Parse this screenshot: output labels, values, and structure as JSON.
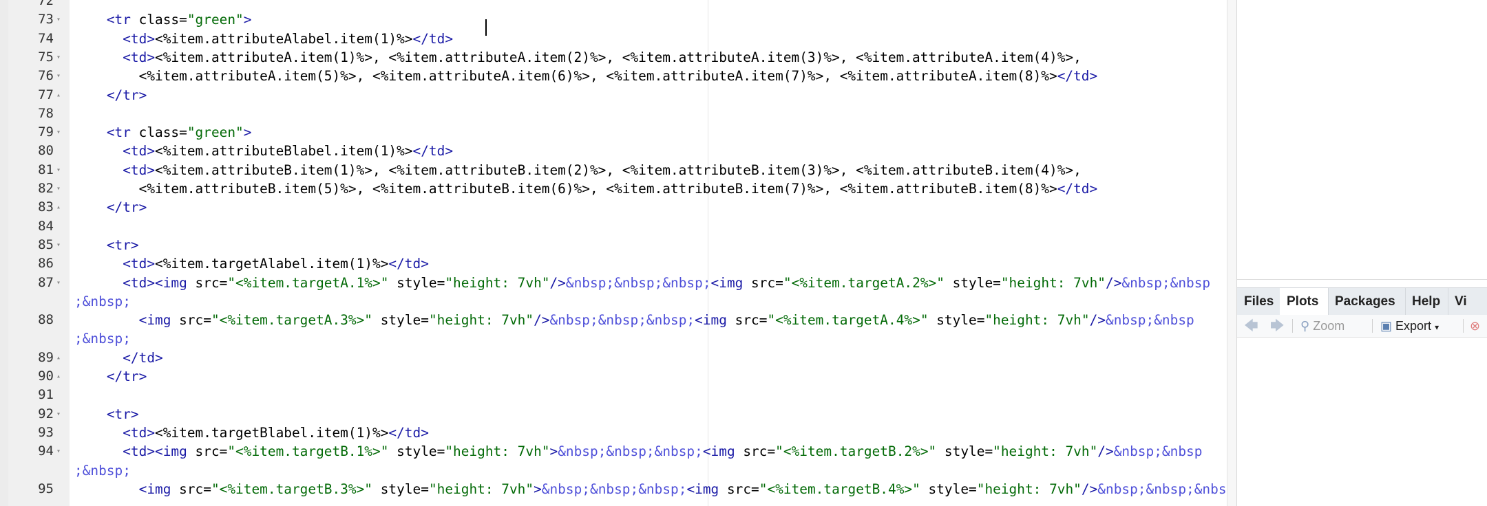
{
  "editor": {
    "lines": [
      {
        "num": "72",
        "fold": "",
        "segs": [
          [
            "",
            ""
          ]
        ]
      },
      {
        "num": "73",
        "fold": "▾",
        "segs": [
          [
            "",
            "    "
          ],
          [
            "tag",
            "<tr"
          ],
          [
            "",
            " class="
          ],
          [
            "str",
            "\"green\""
          ],
          [
            "tag",
            ">"
          ]
        ]
      },
      {
        "num": "74",
        "fold": "",
        "segs": [
          [
            "",
            "      "
          ],
          [
            "tag",
            "<td>"
          ],
          [
            "",
            "<%item.attributeAlabel.item(1)%>"
          ],
          [
            "tag",
            "</td>"
          ]
        ]
      },
      {
        "num": "75",
        "fold": "▾",
        "segs": [
          [
            "",
            "      "
          ],
          [
            "tag",
            "<td>"
          ],
          [
            "",
            "<%item.attributeA.item(1)%>, <%item.attributeA.item(2)%>, <%item.attributeA.item(3)%>, <%item.attributeA.item(4)%>,"
          ]
        ]
      },
      {
        "num": "76",
        "fold": "▾",
        "segs": [
          [
            "",
            "        <%item.attributeA.item(5)%>, <%item.attributeA.item(6)%>, <%item.attributeA.item(7)%>, <%item.attributeA.item(8)%>"
          ],
          [
            "tag",
            "</td>"
          ]
        ]
      },
      {
        "num": "77",
        "fold": "▴",
        "segs": [
          [
            "",
            "    "
          ],
          [
            "tag",
            "</tr>"
          ]
        ]
      },
      {
        "num": "78",
        "fold": "",
        "segs": [
          [
            "",
            ""
          ]
        ]
      },
      {
        "num": "79",
        "fold": "▾",
        "segs": [
          [
            "",
            "    "
          ],
          [
            "tag",
            "<tr"
          ],
          [
            "",
            " class="
          ],
          [
            "str",
            "\"green\""
          ],
          [
            "tag",
            ">"
          ]
        ]
      },
      {
        "num": "80",
        "fold": "",
        "segs": [
          [
            "",
            "      "
          ],
          [
            "tag",
            "<td>"
          ],
          [
            "",
            "<%item.attributeBlabel.item(1)%>"
          ],
          [
            "tag",
            "</td>"
          ]
        ]
      },
      {
        "num": "81",
        "fold": "▾",
        "segs": [
          [
            "",
            "      "
          ],
          [
            "tag",
            "<td>"
          ],
          [
            "",
            "<%item.attributeB.item(1)%>, <%item.attributeB.item(2)%>, <%item.attributeB.item(3)%>, <%item.attributeB.item(4)%>,"
          ]
        ]
      },
      {
        "num": "82",
        "fold": "▾",
        "segs": [
          [
            "",
            "        <%item.attributeB.item(5)%>, <%item.attributeB.item(6)%>, <%item.attributeB.item(7)%>, <%item.attributeB.item(8)%>"
          ],
          [
            "tag",
            "</td>"
          ]
        ]
      },
      {
        "num": "83",
        "fold": "▴",
        "segs": [
          [
            "",
            "    "
          ],
          [
            "tag",
            "</tr>"
          ]
        ]
      },
      {
        "num": "84",
        "fold": "",
        "segs": [
          [
            "",
            ""
          ]
        ]
      },
      {
        "num": "85",
        "fold": "▾",
        "segs": [
          [
            "",
            "    "
          ],
          [
            "tag",
            "<tr>"
          ]
        ]
      },
      {
        "num": "86",
        "fold": "",
        "segs": [
          [
            "",
            "      "
          ],
          [
            "tag",
            "<td>"
          ],
          [
            "",
            "<%item.targetAlabel.item(1)%>"
          ],
          [
            "tag",
            "</td>"
          ]
        ]
      },
      {
        "num": "87",
        "fold": "▾",
        "segs": [
          [
            "",
            "      "
          ],
          [
            "tag",
            "<td><img"
          ],
          [
            "",
            " src="
          ],
          [
            "str",
            "\"<%item.targetA.1%>\""
          ],
          [
            "",
            " style="
          ],
          [
            "str",
            "\"height: 7vh\""
          ],
          [
            "tag",
            "/>"
          ],
          [
            "ent",
            "&nbsp;&nbsp;&nbsp;"
          ],
          [
            "tag",
            "<img"
          ],
          [
            "",
            " src="
          ],
          [
            "str",
            "\"<%item.targetA.2%>\""
          ],
          [
            "",
            " style="
          ],
          [
            "str",
            "\"height: 7vh\""
          ],
          [
            "tag",
            "/>"
          ],
          [
            "ent",
            "&nbsp;&nbsp"
          ]
        ]
      },
      {
        "num": "",
        "fold": "",
        "segs": [
          [
            "ent",
            ";&nbsp;"
          ]
        ]
      },
      {
        "num": "88",
        "fold": "",
        "segs": [
          [
            "",
            "        "
          ],
          [
            "tag",
            "<img"
          ],
          [
            "",
            " src="
          ],
          [
            "str",
            "\"<%item.targetA.3%>\""
          ],
          [
            "",
            " style="
          ],
          [
            "str",
            "\"height: 7vh\""
          ],
          [
            "tag",
            "/>"
          ],
          [
            "ent",
            "&nbsp;&nbsp;&nbsp;"
          ],
          [
            "tag",
            "<img"
          ],
          [
            "",
            " src="
          ],
          [
            "str",
            "\"<%item.targetA.4%>\""
          ],
          [
            "",
            " style="
          ],
          [
            "str",
            "\"height: 7vh\""
          ],
          [
            "tag",
            "/>"
          ],
          [
            "ent",
            "&nbsp;&nbsp"
          ]
        ]
      },
      {
        "num": "",
        "fold": "",
        "segs": [
          [
            "ent",
            ";&nbsp;"
          ]
        ]
      },
      {
        "num": "89",
        "fold": "▴",
        "segs": [
          [
            "",
            "      "
          ],
          [
            "tag",
            "</td>"
          ]
        ]
      },
      {
        "num": "90",
        "fold": "▴",
        "segs": [
          [
            "",
            "    "
          ],
          [
            "tag",
            "</tr>"
          ]
        ]
      },
      {
        "num": "91",
        "fold": "",
        "segs": [
          [
            "",
            ""
          ]
        ]
      },
      {
        "num": "92",
        "fold": "▾",
        "segs": [
          [
            "",
            "    "
          ],
          [
            "tag",
            "<tr>"
          ]
        ]
      },
      {
        "num": "93",
        "fold": "",
        "segs": [
          [
            "",
            "      "
          ],
          [
            "tag",
            "<td>"
          ],
          [
            "",
            "<%item.targetBlabel.item(1)%>"
          ],
          [
            "tag",
            "</td>"
          ]
        ]
      },
      {
        "num": "94",
        "fold": "▾",
        "segs": [
          [
            "",
            "      "
          ],
          [
            "tag",
            "<td><img"
          ],
          [
            "",
            " src="
          ],
          [
            "str",
            "\"<%item.targetB.1%>\""
          ],
          [
            "",
            " style="
          ],
          [
            "str",
            "\"height: 7vh\""
          ],
          [
            "tag",
            ">"
          ],
          [
            "ent",
            "&nbsp;&nbsp;&nbsp;"
          ],
          [
            "tag",
            "<img"
          ],
          [
            "",
            " src="
          ],
          [
            "str",
            "\"<%item.targetB.2%>\""
          ],
          [
            "",
            " style="
          ],
          [
            "str",
            "\"height: 7vh\""
          ],
          [
            "tag",
            "/>"
          ],
          [
            "ent",
            "&nbsp;&nbsp"
          ]
        ]
      },
      {
        "num": "",
        "fold": "",
        "segs": [
          [
            "ent",
            ";&nbsp;"
          ]
        ]
      },
      {
        "num": "95",
        "fold": "",
        "segs": [
          [
            "",
            "        "
          ],
          [
            "tag",
            "<img"
          ],
          [
            "",
            " src="
          ],
          [
            "str",
            "\"<%item.targetB.3%>\""
          ],
          [
            "",
            " style="
          ],
          [
            "str",
            "\"height: 7vh\""
          ],
          [
            "tag",
            ">"
          ],
          [
            "ent",
            "&nbsp;&nbsp;&nbsp;"
          ],
          [
            "tag",
            "<img"
          ],
          [
            "",
            " src="
          ],
          [
            "str",
            "\"<%item.targetB.4%>\""
          ],
          [
            "",
            " style="
          ],
          [
            "str",
            "\"height: 7vh\""
          ],
          [
            "tag",
            "/>"
          ],
          [
            "ent",
            "&nbsp;&nbsp;&nbsp"
          ]
        ]
      },
      {
        "num": "",
        "fold": "",
        "segs": [
          [
            "",
            "."
          ]
        ]
      }
    ]
  },
  "right_pane": {
    "tabs": [
      {
        "label": "Files",
        "active": false
      },
      {
        "label": "Plots",
        "active": true
      },
      {
        "label": "Packages",
        "active": false
      },
      {
        "label": "Help",
        "active": false
      },
      {
        "label": "Vi",
        "active": false
      }
    ],
    "toolbar": {
      "zoom_label": "Zoom",
      "export_label": "Export"
    }
  },
  "colors": {
    "tag": "#1a1aa6",
    "string": "#036a07",
    "entity": "#4f50d9"
  }
}
